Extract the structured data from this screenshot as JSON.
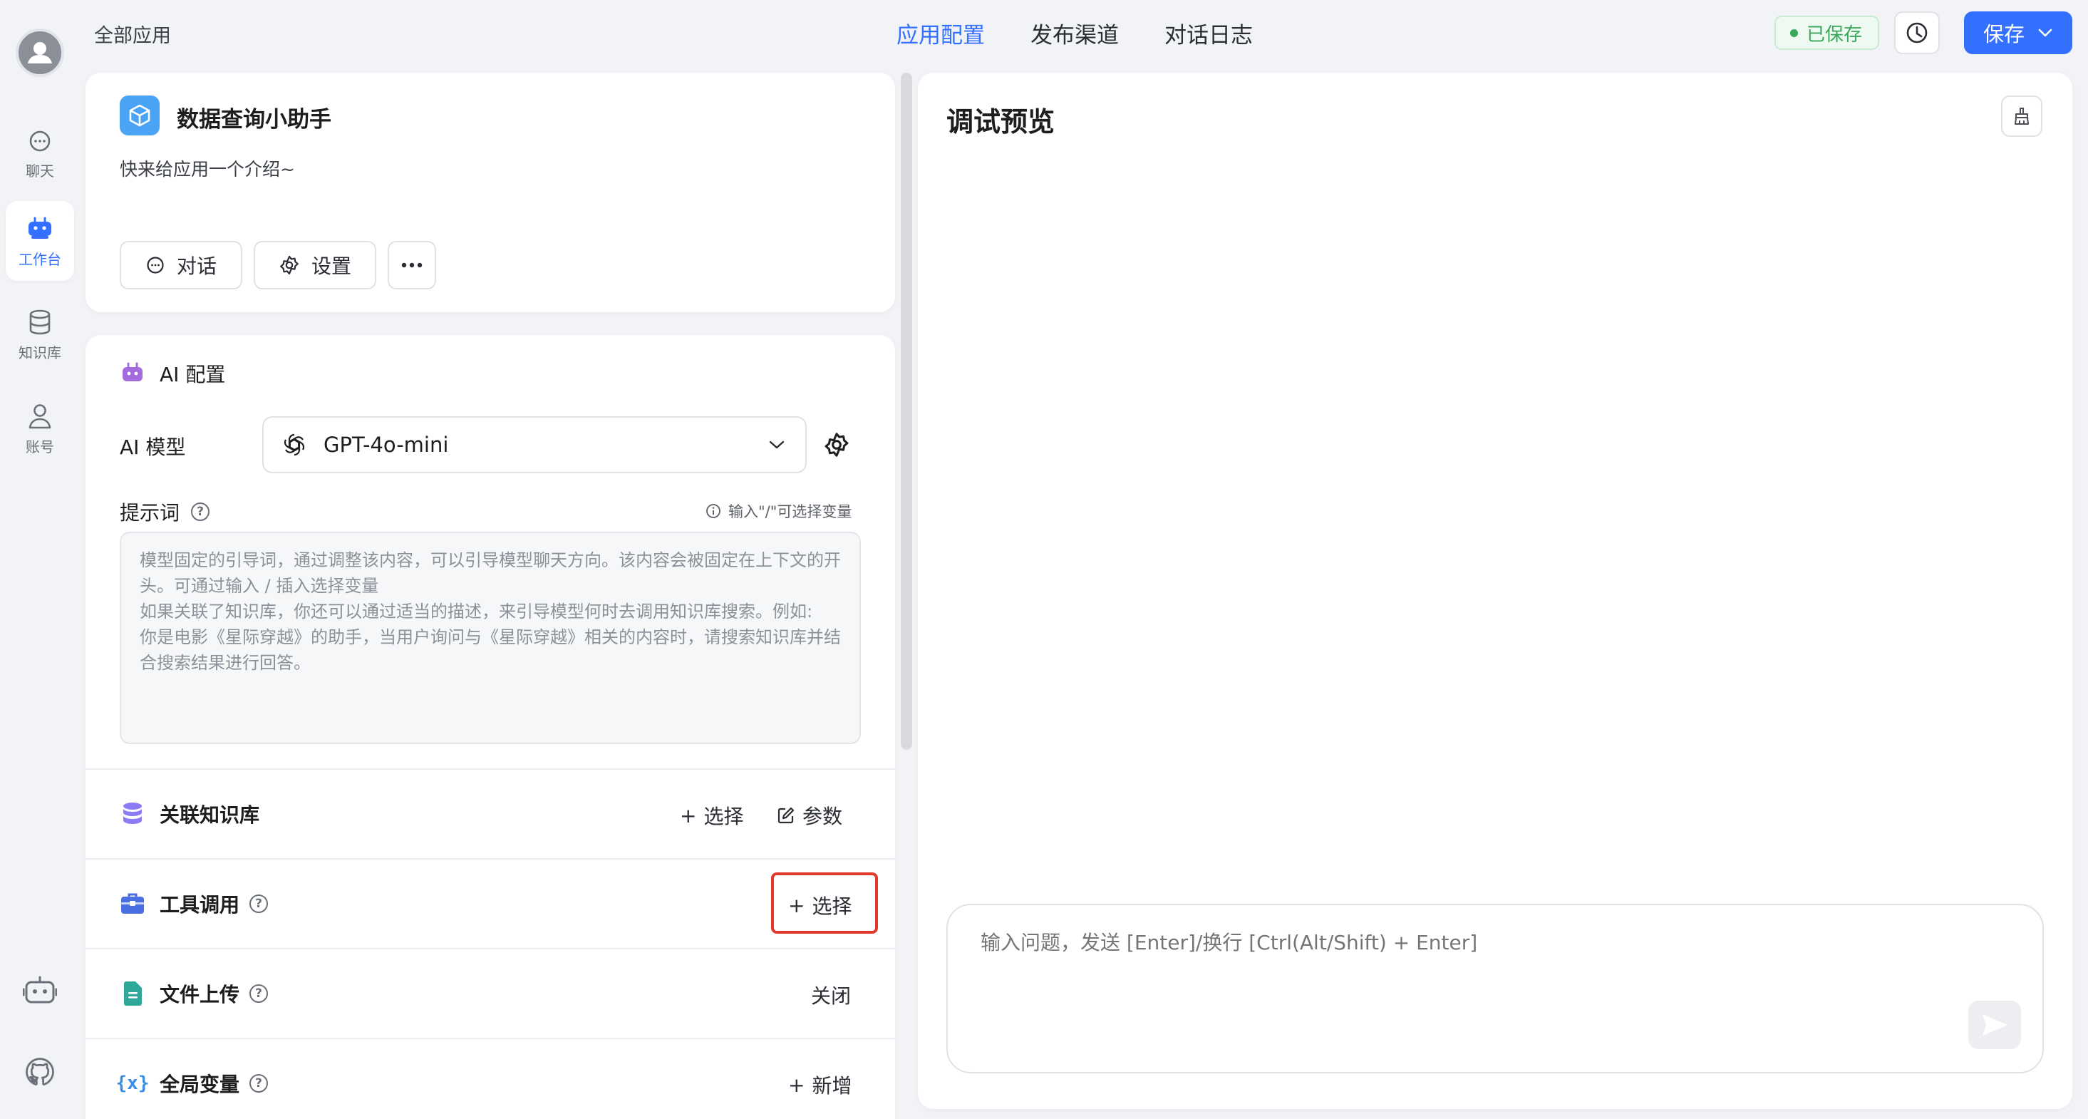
{
  "nav": {
    "items": [
      {
        "label": "聊天"
      },
      {
        "label": "工作台"
      },
      {
        "label": "知识库"
      },
      {
        "label": "账号"
      }
    ]
  },
  "header": {
    "breadcrumb": "全部应用",
    "tabs": [
      {
        "label": "应用配置",
        "active": true
      },
      {
        "label": "发布渠道",
        "active": false
      },
      {
        "label": "对话日志",
        "active": false
      }
    ],
    "saved_status": "已保存",
    "save_label": "保存"
  },
  "app": {
    "name": "数据查询小助手",
    "intro": "快来给应用一个介绍~",
    "chat_button": "对话",
    "settings_button": "设置"
  },
  "ai_config": {
    "title": "AI 配置",
    "model_label": "AI 模型",
    "model_value": "GPT-4o-mini",
    "prompt_label": "提示词",
    "prompt_hint": "输入\"/\"可选择变量",
    "prompt_placeholder": "模型固定的引导词，通过调整该内容，可以引导模型聊天方向。该内容会被固定在上下文的开头。可通过输入 / 插入选择变量\n如果关联了知识库，你还可以通过适当的描述，来引导模型何时去调用知识库搜索。例如:\n你是电影《星际穿越》的助手，当用户询问与《星际穿越》相关的内容时，请搜索知识库并结合搜索结果进行回答。"
  },
  "sections": {
    "knowledge": {
      "label": "关联知识库",
      "select": "选择",
      "params": "参数"
    },
    "tools": {
      "label": "工具调用",
      "select": "选择"
    },
    "upload": {
      "label": "文件上传",
      "status": "关闭"
    },
    "variables": {
      "label": "全局变量",
      "add": "新增"
    }
  },
  "preview": {
    "title": "调试预览",
    "input_placeholder": "输入问题，发送 [Enter]/换行 [Ctrl(Alt/Shift) + Enter]"
  },
  "colors": {
    "accent": "#3370ff",
    "saved": "#39a85a",
    "highlight": "#e0392b"
  }
}
